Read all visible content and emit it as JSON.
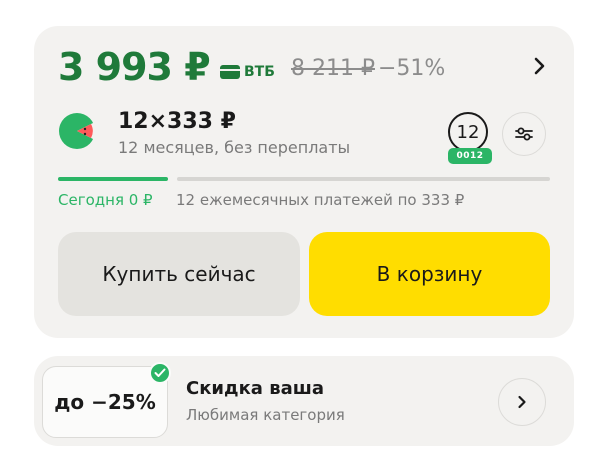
{
  "price": {
    "current": "3 993 ₽",
    "bank": "ВТБ",
    "old": "8 211 ₽",
    "discount": "−51%"
  },
  "installment": {
    "amount": "12×333 ₽",
    "subtitle": "12 месяцев, без переплаты",
    "term": "12",
    "term_badge": "0012",
    "today_label": "Сегодня 0 ₽",
    "monthly_label": "12 ежемесячных платежей по 333 ₽",
    "paid_fraction": 0.0
  },
  "actions": {
    "buy_now": "Купить сейчас",
    "to_cart": "В корзину"
  },
  "promo": {
    "badge": "до −25%",
    "title": "Скидка ваша",
    "subtitle": "Любимая категория"
  },
  "colors": {
    "price_green": "#1f7a3a",
    "accent_green": "#2bb566",
    "cart_yellow": "#ffdd00",
    "card_bg": "#f3f2f0"
  },
  "icons": {
    "bank": "bank-card-icon",
    "more": "chevron-right-icon",
    "split": "watermelon-icon",
    "settings": "sliders-icon",
    "verified": "check-icon"
  }
}
